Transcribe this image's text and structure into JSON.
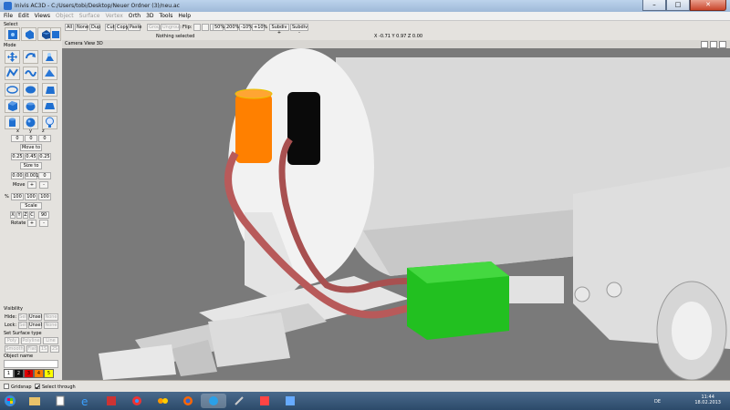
{
  "window": {
    "title": "Inivis AC3D - C:/Users/tobi/Desktop/Neuer Ordner (3)/neu.ac",
    "min": "–",
    "max": "□",
    "close": "✕"
  },
  "menu": [
    "File",
    "Edit",
    "Views",
    "Object",
    "Surface",
    "Vertex",
    "Orth",
    "3D",
    "Tools",
    "Help"
  ],
  "left": {
    "select_label": "Select",
    "mode_label": "Mode",
    "xyz": [
      "x",
      "y",
      "z"
    ],
    "move_vals": [
      "0",
      "0",
      "0"
    ],
    "move_to": "Move to",
    "size_vals": [
      "0.25",
      "0.45",
      "0.25"
    ],
    "size_to": "Size to",
    "mv_vals": [
      "0.00",
      "0.001",
      "0"
    ],
    "move": "Move",
    "plus": "+",
    "minus": "-",
    "pct": "%",
    "scale_vals": [
      "100",
      "100",
      "100"
    ],
    "scale": "Scale",
    "rot_axes": [
      "X",
      "Y",
      "Z",
      "C"
    ],
    "rot_val": "90",
    "rotate": "Rotate",
    "visibility": "Visibility",
    "hide": "Hide:",
    "lock": "Lock:",
    "sel": "Sel",
    "unsel": "Unsel",
    "none": "None",
    "set_surface": "Set Surface type",
    "poly": "Poly",
    "polyline": "Polyline",
    "line": "Line",
    "smooth": "Smooth",
    "flat": "Flat",
    "one_s": "1S",
    "two_s": "2S",
    "object_name": "Object name",
    "palette": [
      {
        "n": "1",
        "c": "#ffffff"
      },
      {
        "n": "2",
        "c": "#111111"
      },
      {
        "n": "3",
        "c": "#e00000"
      },
      {
        "n": "4",
        "c": "#ff8000"
      },
      {
        "n": "5",
        "c": "#ffff00"
      }
    ]
  },
  "toolbar": {
    "all": "All",
    "none": "None",
    "dup": "Dup",
    "cut": "Cut",
    "copy": "Copy",
    "paste": "Paste",
    "group": "Group",
    "ungroup": "Ungroup",
    "flip": "Flip:",
    "z50": "50%",
    "z200": "200%",
    "m10": "-10%",
    "p10": "+10%",
    "subdiv_plus": "Subdiv +",
    "subdiv_minus": "Subdiv -",
    "status": "Nothing selected",
    "coords": "X -0.71 Y 0.97 Z 0.00"
  },
  "viewport": {
    "header": "Camera  View  3D"
  },
  "status": {
    "gridsnap": "Gridsnap",
    "select_through": "Select through"
  },
  "tray": {
    "lang": "DE",
    "time": "11:44",
    "date": "18.02.2013"
  },
  "colors": {
    "orange": "#ff8000",
    "hose": "#b85a5a",
    "green": "#22c020",
    "white": "#f0f0f0",
    "grey": "#7a7a7a"
  }
}
